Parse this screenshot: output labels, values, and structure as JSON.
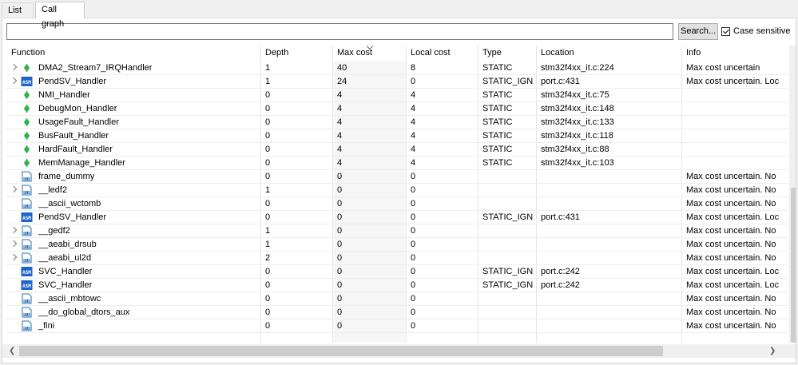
{
  "tabs": [
    {
      "label": "List"
    },
    {
      "label": "Call graph"
    }
  ],
  "search": {
    "value": "",
    "button_label": "Search...",
    "case_label": "Case sensitive",
    "case_checked": true
  },
  "columns": [
    "Function",
    "Depth",
    "Max cost",
    "Local cost",
    "Type",
    "Location",
    "Info"
  ],
  "rows": [
    {
      "expandable": true,
      "icon": "function-icon",
      "fn": "DMA2_Stream7_IRQHandler",
      "depth": "1",
      "max": "40",
      "local": "8",
      "type": "STATIC",
      "loc": "stm32f4xx_it.c:224",
      "info": "Max cost uncertain"
    },
    {
      "expandable": true,
      "icon": "asm-icon",
      "fn": "PendSV_Handler",
      "depth": "1",
      "max": "24",
      "local": "0",
      "type": "STATIC_IGN...",
      "loc": "port.c:431",
      "info": "Max cost uncertain. Loc"
    },
    {
      "expandable": false,
      "icon": "function-icon",
      "fn": "NMI_Handler",
      "depth": "0",
      "max": "4",
      "local": "4",
      "type": "STATIC",
      "loc": "stm32f4xx_it.c:75",
      "info": ""
    },
    {
      "expandable": false,
      "icon": "function-icon",
      "fn": "DebugMon_Handler",
      "depth": "0",
      "max": "4",
      "local": "4",
      "type": "STATIC",
      "loc": "stm32f4xx_it.c:148",
      "info": ""
    },
    {
      "expandable": false,
      "icon": "function-icon",
      "fn": "UsageFault_Handler",
      "depth": "0",
      "max": "4",
      "local": "4",
      "type": "STATIC",
      "loc": "stm32f4xx_it.c:133",
      "info": ""
    },
    {
      "expandable": false,
      "icon": "function-icon",
      "fn": "BusFault_Handler",
      "depth": "0",
      "max": "4",
      "local": "4",
      "type": "STATIC",
      "loc": "stm32f4xx_it.c:118",
      "info": ""
    },
    {
      "expandable": false,
      "icon": "function-icon",
      "fn": "HardFault_Handler",
      "depth": "0",
      "max": "4",
      "local": "4",
      "type": "STATIC",
      "loc": "stm32f4xx_it.c:88",
      "info": ""
    },
    {
      "expandable": false,
      "icon": "function-icon",
      "fn": "MemManage_Handler",
      "depth": "0",
      "max": "4",
      "local": "4",
      "type": "STATIC",
      "loc": "stm32f4xx_it.c:103",
      "info": ""
    },
    {
      "expandable": false,
      "icon": "binary-file-icon",
      "fn": "frame_dummy",
      "depth": "0",
      "max": "0",
      "local": "0",
      "type": "",
      "loc": "",
      "info": "Max cost uncertain. No"
    },
    {
      "expandable": true,
      "icon": "binary-file-icon",
      "fn": "__ledf2",
      "depth": "1",
      "max": "0",
      "local": "0",
      "type": "",
      "loc": "",
      "info": "Max cost uncertain. No"
    },
    {
      "expandable": false,
      "icon": "binary-file-icon",
      "fn": "__ascii_wctomb",
      "depth": "0",
      "max": "0",
      "local": "0",
      "type": "",
      "loc": "",
      "info": "Max cost uncertain. No"
    },
    {
      "expandable": false,
      "icon": "asm-icon",
      "fn": "PendSV_Handler",
      "depth": "0",
      "max": "0",
      "local": "0",
      "type": "STATIC_IGN...",
      "loc": "port.c:431",
      "info": "Max cost uncertain. Loc"
    },
    {
      "expandable": true,
      "icon": "binary-file-icon",
      "fn": "__gedf2",
      "depth": "1",
      "max": "0",
      "local": "0",
      "type": "",
      "loc": "",
      "info": "Max cost uncertain. No"
    },
    {
      "expandable": true,
      "icon": "binary-file-icon",
      "fn": "__aeabi_drsub",
      "depth": "1",
      "max": "0",
      "local": "0",
      "type": "",
      "loc": "",
      "info": "Max cost uncertain. No"
    },
    {
      "expandable": true,
      "icon": "binary-file-icon",
      "fn": "__aeabi_ul2d",
      "depth": "2",
      "max": "0",
      "local": "0",
      "type": "",
      "loc": "",
      "info": "Max cost uncertain. No"
    },
    {
      "expandable": false,
      "icon": "asm-icon",
      "fn": "SVC_Handler",
      "depth": "0",
      "max": "0",
      "local": "0",
      "type": "STATIC_IGN...",
      "loc": "port.c:242",
      "info": "Max cost uncertain. Loc"
    },
    {
      "expandable": false,
      "icon": "asm-icon",
      "fn": "SVC_Handler",
      "depth": "0",
      "max": "0",
      "local": "0",
      "type": "STATIC_IGN...",
      "loc": "port.c:242",
      "info": "Max cost uncertain. Loc"
    },
    {
      "expandable": false,
      "icon": "binary-file-icon",
      "fn": "__ascii_mbtowc",
      "depth": "0",
      "max": "0",
      "local": "0",
      "type": "",
      "loc": "",
      "info": "Max cost uncertain. No"
    },
    {
      "expandable": false,
      "icon": "binary-file-icon",
      "fn": "__do_global_dtors_aux",
      "depth": "0",
      "max": "0",
      "local": "0",
      "type": "",
      "loc": "",
      "info": "Max cost uncertain. No"
    },
    {
      "expandable": false,
      "icon": "binary-file-icon",
      "fn": "_fini",
      "depth": "0",
      "max": "0",
      "local": "0",
      "type": "",
      "loc": "",
      "info": "Max cost uncertain. No"
    }
  ],
  "colors": {
    "function_icon": "#2fb24a",
    "asm_icon": "#1f64c8",
    "binary_icon": "#2a6fb5"
  }
}
